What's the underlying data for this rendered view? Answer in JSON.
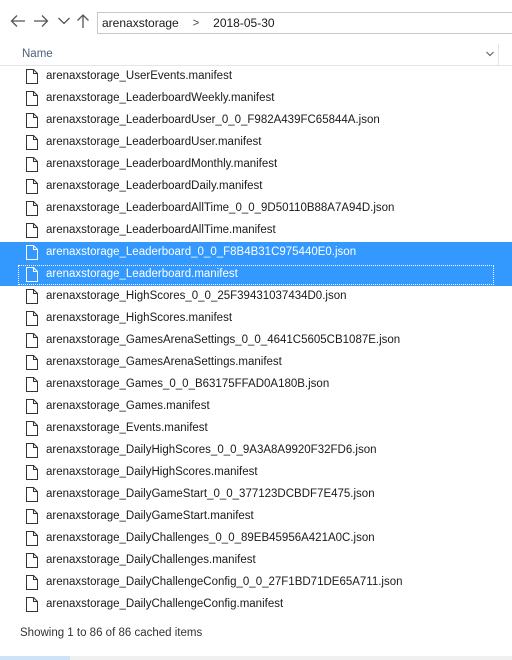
{
  "navigation": {
    "back_icon": "back-arrow-icon",
    "forward_icon": "forward-arrow-icon",
    "recent_icon": "chevron-down-icon",
    "up_icon": "up-arrow-icon"
  },
  "breadcrumb": {
    "items": [
      "arenaxstorage",
      "2018-05-30"
    ],
    "separator": ">"
  },
  "list_header": {
    "name_label": "Name"
  },
  "files": [
    {
      "name": "arenaxstorage_UserEvents.manifest",
      "selected": false
    },
    {
      "name": "arenaxstorage_LeaderboardWeekly.manifest",
      "selected": false
    },
    {
      "name": "arenaxstorage_LeaderboardUser_0_0_F982A439FC65844A.json",
      "selected": false
    },
    {
      "name": "arenaxstorage_LeaderboardUser.manifest",
      "selected": false
    },
    {
      "name": "arenaxstorage_LeaderboardMonthly.manifest",
      "selected": false
    },
    {
      "name": "arenaxstorage_LeaderboardDaily.manifest",
      "selected": false
    },
    {
      "name": "arenaxstorage_LeaderboardAllTime_0_0_9D50110B88A7A94D.json",
      "selected": false
    },
    {
      "name": "arenaxstorage_LeaderboardAllTime.manifest",
      "selected": false
    },
    {
      "name": "arenaxstorage_Leaderboard_0_0_F8B4B31C975440E0.json",
      "selected": true
    },
    {
      "name": "arenaxstorage_Leaderboard.manifest",
      "selected": true,
      "focused": true
    },
    {
      "name": "arenaxstorage_HighScores_0_0_25F39431037434D0.json",
      "selected": false
    },
    {
      "name": "arenaxstorage_HighScores.manifest",
      "selected": false
    },
    {
      "name": "arenaxstorage_GamesArenaSettings_0_0_4641C5605CB1087E.json",
      "selected": false
    },
    {
      "name": "arenaxstorage_GamesArenaSettings.manifest",
      "selected": false
    },
    {
      "name": "arenaxstorage_Games_0_0_B63175FFAD0A180B.json",
      "selected": false
    },
    {
      "name": "arenaxstorage_Games.manifest",
      "selected": false
    },
    {
      "name": "arenaxstorage_Events.manifest",
      "selected": false
    },
    {
      "name": "arenaxstorage_DailyHighScores_0_0_9A3A8A9920F32FD6.json",
      "selected": false
    },
    {
      "name": "arenaxstorage_DailyHighScores.manifest",
      "selected": false
    },
    {
      "name": "arenaxstorage_DailyGameStart_0_0_377123DCBDF7E475.json",
      "selected": false
    },
    {
      "name": "arenaxstorage_DailyGameStart.manifest",
      "selected": false
    },
    {
      "name": "arenaxstorage_DailyChallenges_0_0_89EB45956A421A0C.json",
      "selected": false
    },
    {
      "name": "arenaxstorage_DailyChallenges.manifest",
      "selected": false
    },
    {
      "name": "arenaxstorage_DailyChallengeConfig_0_0_27F1BD71DE65A711.json",
      "selected": false
    },
    {
      "name": "arenaxstorage_DailyChallengeConfig.manifest",
      "selected": false
    }
  ],
  "file_icon": "document-icon",
  "status": {
    "text": "Showing 1 to 86 of 86 cached items"
  },
  "colors": {
    "selection": "#3399ff",
    "header_text": "#4c607a"
  }
}
